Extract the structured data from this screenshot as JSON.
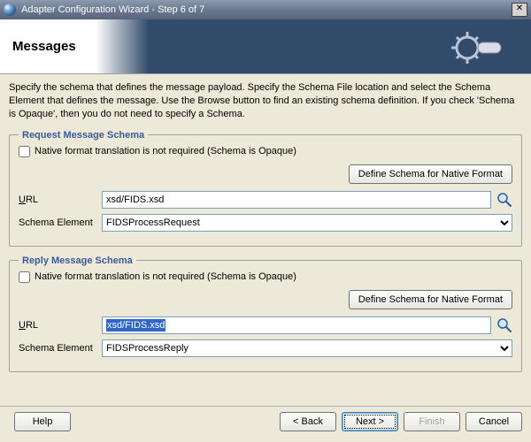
{
  "window": {
    "title": "Adapter Configuration Wizard - Step 6 of 7"
  },
  "page": {
    "title": "Messages",
    "description": "Specify the schema that defines the message payload.  Specify the Schema File location and select the Schema Element that defines the message. Use the Browse button to find an existing schema definition. If you check 'Schema is Opaque', then you do not need to specify a Schema."
  },
  "request": {
    "legend": "Request Message Schema",
    "checkbox_label": "Native format translation is not required (Schema is Opaque)",
    "checkbox_checked": false,
    "define_button": "Define Schema for Native Format",
    "url_label": "URL",
    "url_value": "xsd/FIDS.xsd",
    "schema_label": "Schema Element",
    "schema_value": "FIDSProcessRequest"
  },
  "reply": {
    "legend": "Reply Message Schema",
    "checkbox_label": "Native format translation is not required (Schema is Opaque)",
    "checkbox_checked": false,
    "define_button": "Define Schema for Native Format",
    "url_label": "URL",
    "url_value": "xsd/FIDS.xsd",
    "url_selected": true,
    "schema_label": "Schema Element",
    "schema_value": "FIDSProcessReply"
  },
  "buttons": {
    "help": "Help",
    "back": "< Back",
    "next": "Next >",
    "finish": "Finish",
    "cancel": "Cancel"
  }
}
